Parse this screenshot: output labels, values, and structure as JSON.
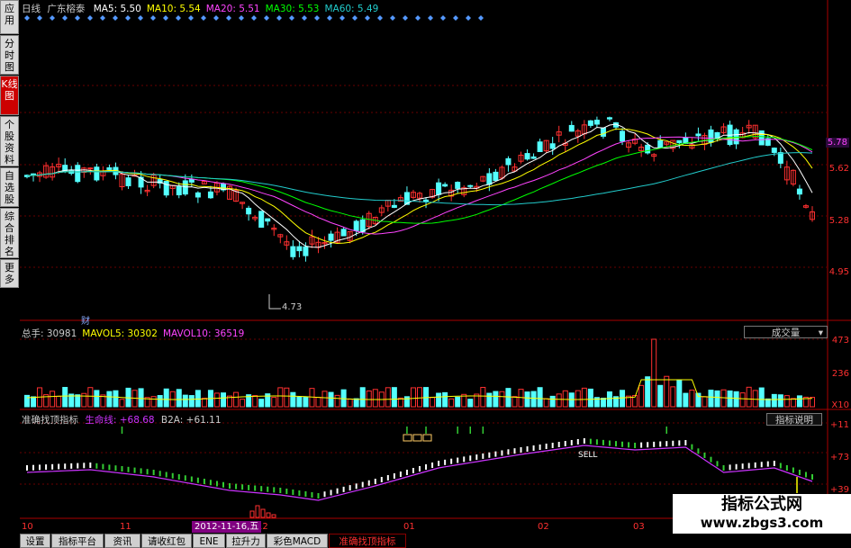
{
  "sidebar": {
    "items": [
      {
        "label": "应用",
        "active": false
      },
      {
        "label": "分时图",
        "active": false
      },
      {
        "label": "K线图",
        "active": true
      },
      {
        "label": "个股资料",
        "active": false
      },
      {
        "label": "自选股",
        "active": false
      },
      {
        "label": "综合排名",
        "active": false
      },
      {
        "label": "更多",
        "active": false
      }
    ]
  },
  "price_panel": {
    "period_label": "日线",
    "stock_name": "广东榕泰",
    "ma": [
      {
        "label": "MA5: 5.50",
        "color": "#ffffff"
      },
      {
        "label": "MA10: 5.54",
        "color": "#ffff00"
      },
      {
        "label": "MA20: 5.51",
        "color": "#ff44ff"
      },
      {
        "label": "MA30: 5.53",
        "color": "#00ff00"
      },
      {
        "label": "MA60: 5.49",
        "color": "#22cccc"
      }
    ],
    "axis_labels": [
      "5.78",
      "5.62",
      "5.28",
      "4.95"
    ],
    "low_marker": "4.73",
    "finance_marker": "财"
  },
  "volume_panel": {
    "labels": [
      {
        "label": "总手: 30981",
        "color": "#cccccc"
      },
      {
        "label": "MAVOL5: 30302",
        "color": "#ffff00"
      },
      {
        "label": "MAVOL10: 36519",
        "color": "#ff44ff"
      }
    ],
    "dropdown": "成交量",
    "axis_labels": [
      "473",
      "236",
      "X10"
    ]
  },
  "indicator_panel": {
    "name": "准确找顶指标",
    "line1": "生命线: +68.68",
    "line2": "B2A: +61.11",
    "button": "指标说明",
    "axis_labels": [
      "+11",
      "+73",
      "+39"
    ],
    "sell_label": "SELL"
  },
  "time_axis": {
    "labels": [
      "10",
      "11",
      "12",
      "01",
      "02",
      "03"
    ],
    "cursor_date": "2012-11-16,五"
  },
  "tabs": [
    {
      "label": "设置",
      "active": false
    },
    {
      "label": "指标平台",
      "active": false
    },
    {
      "label": "资讯",
      "active": false
    },
    {
      "label": "请收红包",
      "active": false
    },
    {
      "label": "ENE",
      "active": false
    },
    {
      "label": "拉升力",
      "active": false
    },
    {
      "label": "彩色MACD",
      "active": false
    },
    {
      "label": "准确找顶指标",
      "active": true
    }
  ],
  "watermark": {
    "title": "指标公式网",
    "url": "www.zbgs3.com"
  },
  "colors": {
    "up": "#ff3030",
    "down": "#54ffff",
    "grid": "#8b0000",
    "ma5": "#ffffff",
    "ma10": "#ffff00",
    "ma20": "#ff44ff",
    "ma30": "#00ff00",
    "ma60": "#22cccc",
    "active_tab_text": "#ff3030",
    "purple_line": "#cc33ff"
  }
}
